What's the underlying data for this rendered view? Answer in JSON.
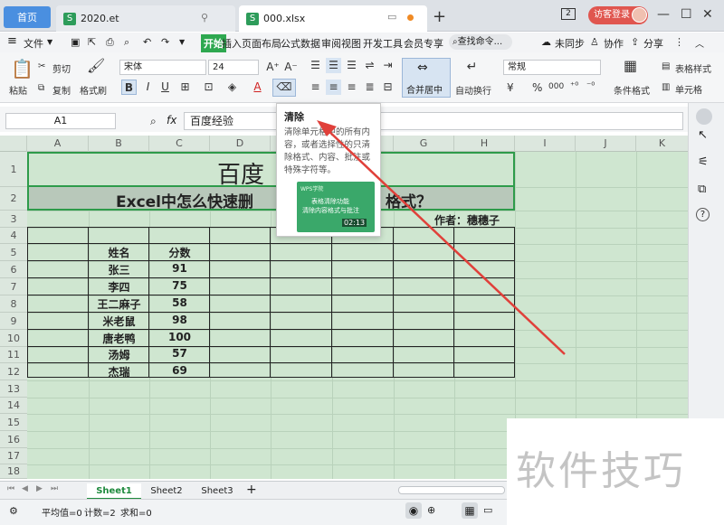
{
  "titlebar": {
    "home_tab": "首页",
    "file_tab_1": "2020.et",
    "file_tab_2": "000.xlsx",
    "file_icon_letter": "S",
    "badge": "2",
    "login_label": "访客登录",
    "new_tab_icon": "plus-icon"
  },
  "menu": {
    "file": "文件",
    "items": [
      "开始",
      "插入",
      "页面布局",
      "公式",
      "数据",
      "审阅",
      "视图",
      "开发工具",
      "会员专享"
    ],
    "search": "查找命令...",
    "sync": "未同步",
    "collab": "协作",
    "share": "分享"
  },
  "toolbar": {
    "cut": "剪切",
    "copy": "复制",
    "paste": "粘贴",
    "format_painter": "格式刷",
    "font_name": "宋体",
    "font_size": "24",
    "merge_center": "合并居中",
    "wrap_text": "自动换行",
    "number_format": "常规",
    "conditional_format": "条件格式",
    "table_style": "表格样式",
    "cell_format": "单元格",
    "currency": "¥",
    "percent": "%",
    "thousands": "000"
  },
  "formula_bar": {
    "name_box": "A1",
    "fx": "fx",
    "content": "百度经验"
  },
  "sheet": {
    "columns": [
      "A",
      "B",
      "C",
      "D",
      "E",
      "F",
      "G",
      "H",
      "I",
      "J",
      "K"
    ],
    "rows": [
      "1",
      "2",
      "3",
      "4",
      "5",
      "6",
      "7",
      "8",
      "9",
      "10",
      "11",
      "12",
      "13",
      "14",
      "15",
      "16",
      "17",
      "18",
      "19"
    ],
    "title_visible": "百度",
    "subtitle_left": "Excel中怎么快速删",
    "subtitle_right": "格式？",
    "author": "作者：穗穗子",
    "header_name": "姓名",
    "header_score": "分数",
    "names": [
      "张三",
      "李四",
      "王二麻子",
      "米老鼠",
      "唐老鸭",
      "汤姆",
      "杰瑞"
    ],
    "scores": [
      "91",
      "75",
      "58",
      "98",
      "100",
      "57",
      "69"
    ]
  },
  "tooltip": {
    "title": "清除",
    "description": "清除单元格中的所有内容，或者选择性的只清除格式、内容、批注或特殊字符等。",
    "video_brand": "WPS学院",
    "video_title_1": "表格清除功能",
    "video_title_2": "清除内容格式与批注",
    "video_duration": "02:13"
  },
  "sheet_tabs": [
    "Sheet1",
    "Sheet2",
    "Sheet3"
  ],
  "status": {
    "average": "平均值=0",
    "count": "计数=2",
    "sum": "求和=0"
  },
  "watermark": "软件技巧",
  "colors": {
    "accent_green": "#2ea850",
    "sheet_bg": "#cfe6d0",
    "arrow": "#e0403a",
    "login_red": "#e0564f",
    "home_blue": "#4a8fe0"
  }
}
